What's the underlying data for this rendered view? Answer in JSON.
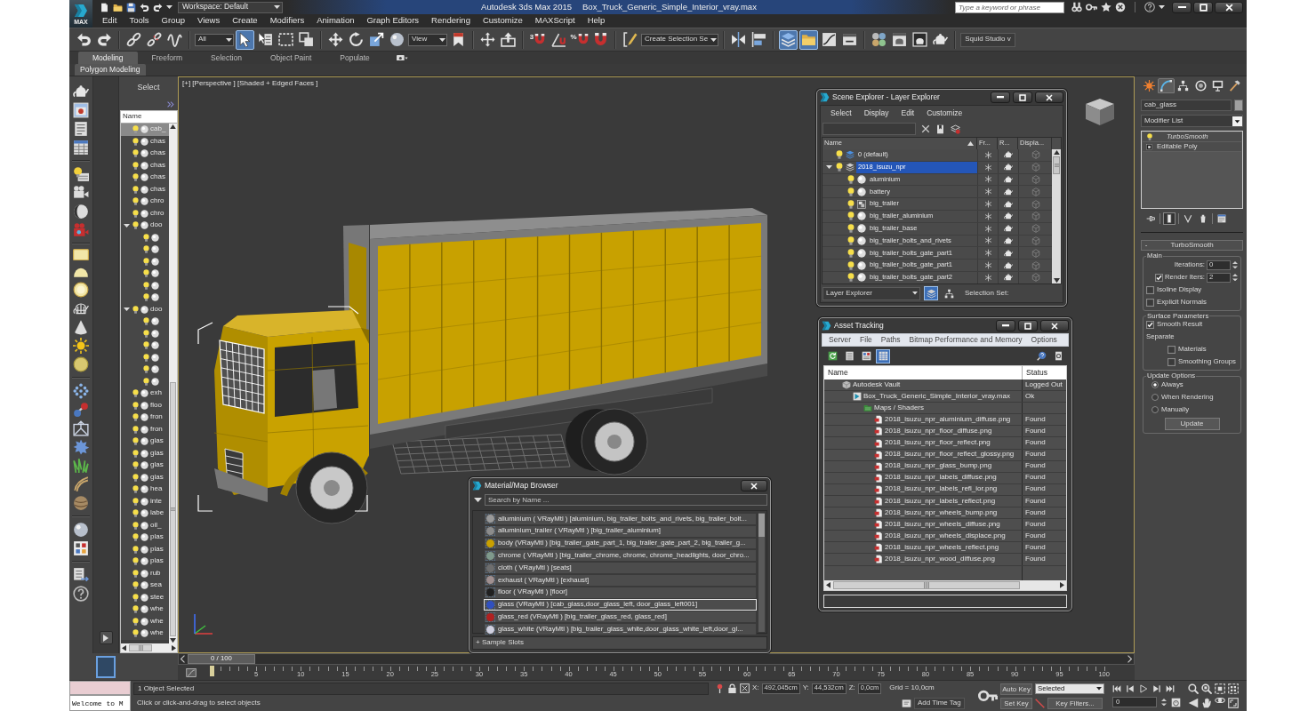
{
  "title_bar": {
    "app_button": "MAX",
    "workspace": "Workspace: Default",
    "app_name": "Autodesk 3ds Max 2015",
    "file_name": "Box_Truck_Generic_Simple_Interior_vray.max",
    "search": {
      "placeholder": "Type a keyword or phrase"
    }
  },
  "menu": [
    "Edit",
    "Tools",
    "Group",
    "Views",
    "Create",
    "Modifiers",
    "Animation",
    "Graph Editors",
    "Rendering",
    "Customize",
    "MAXScript",
    "Help"
  ],
  "main_toolbar": [
    {
      "kind": "button",
      "selected": false
    },
    {
      "kind": "button",
      "selected": false
    },
    {
      "kind": "button",
      "selected": false
    },
    {
      "kind": "button",
      "selected": false
    },
    {
      "kind": "button",
      "selected": false
    },
    {
      "kind": "dropdown",
      "value": "All"
    },
    {
      "kind": "button",
      "selected": true
    },
    {
      "kind": "button",
      "selected": false
    },
    {
      "kind": "button",
      "selected": false
    },
    {
      "kind": "button",
      "selected": false
    },
    {
      "kind": "button",
      "selected": false
    },
    {
      "kind": "button",
      "selected": false
    },
    {
      "kind": "button",
      "selected": false
    },
    {
      "kind": "button",
      "selected": false
    },
    {
      "kind": "dropdown",
      "value": "View"
    },
    {
      "kind": "button",
      "selected": false
    },
    {
      "kind": "button",
      "selected": false
    },
    {
      "kind": "button",
      "selected": false
    },
    {
      "kind": "snap",
      "label": "3",
      "selected": false
    },
    {
      "kind": "button",
      "selected": false
    },
    {
      "kind": "snap",
      "label": "%",
      "selected": false
    },
    {
      "kind": "button",
      "selected": false
    },
    {
      "kind": "button",
      "selected": false
    },
    {
      "kind": "dropdown",
      "value": "Create Selection Se"
    },
    {
      "kind": "button",
      "selected": false
    },
    {
      "kind": "button",
      "selected": false
    },
    {
      "kind": "button",
      "selected": true
    },
    {
      "kind": "button",
      "selected": true
    },
    {
      "kind": "button",
      "selected": false
    },
    {
      "kind": "button",
      "selected": false
    },
    {
      "kind": "button",
      "selected": false
    },
    {
      "kind": "button",
      "selected": false
    },
    {
      "kind": "button",
      "selected": false
    },
    {
      "kind": "button",
      "selected": false
    },
    {
      "kind": "field",
      "value": "Squid Studio v"
    }
  ],
  "ribbon": {
    "tabs": [
      {
        "label": "Modeling",
        "selected": true
      },
      {
        "label": "Freeform",
        "selected": false
      },
      {
        "label": "Selection",
        "selected": false
      },
      {
        "label": "Object Paint",
        "selected": false
      },
      {
        "label": "Populate",
        "selected": false
      }
    ],
    "panel": "Polygon Modeling"
  },
  "scene_explorer": {
    "header": "Select",
    "column": "Name",
    "items": [
      {
        "name": "cab_",
        "selected": true,
        "expanded": false
      },
      {
        "name": "chas",
        "selected": false,
        "expanded": false
      },
      {
        "name": "chas",
        "selected": false,
        "expanded": false
      },
      {
        "name": "chas",
        "selected": false,
        "expanded": false
      },
      {
        "name": "chas",
        "selected": false,
        "expanded": false
      },
      {
        "name": "chas",
        "selected": false,
        "expanded": false
      },
      {
        "name": "chro",
        "selected": false,
        "expanded": false
      },
      {
        "name": "chro",
        "selected": false,
        "expanded": false
      },
      {
        "name": "doo",
        "selected": false,
        "expanded": true,
        "children": [
          {
            "selected": false
          },
          {
            "selected": false
          },
          {
            "selected": false
          },
          {
            "selected": false
          },
          {
            "selected": false
          },
          {
            "selected": false
          }
        ]
      },
      {
        "name": "doo",
        "selected": false,
        "expanded": true,
        "children": [
          {
            "selected": false
          },
          {
            "selected": false
          },
          {
            "selected": false
          },
          {
            "selected": false
          },
          {
            "selected": false
          },
          {
            "selected": false
          }
        ]
      },
      {
        "name": "exh",
        "selected": false,
        "expanded": false
      },
      {
        "name": "floo",
        "selected": false,
        "expanded": false
      },
      {
        "name": "fron",
        "selected": false,
        "expanded": false
      },
      {
        "name": "fron",
        "selected": false,
        "expanded": false
      },
      {
        "name": "glas",
        "selected": false,
        "expanded": false
      },
      {
        "name": "glas",
        "selected": false,
        "expanded": false
      },
      {
        "name": "glas",
        "selected": false,
        "expanded": false
      },
      {
        "name": "glas",
        "selected": false,
        "expanded": false
      },
      {
        "name": "hea",
        "selected": false,
        "expanded": false
      },
      {
        "name": "inte",
        "selected": false,
        "expanded": false
      },
      {
        "name": "labe",
        "selected": false,
        "expanded": false
      },
      {
        "name": "oil_",
        "selected": false,
        "expanded": false
      },
      {
        "name": "plas",
        "selected": false,
        "expanded": false
      },
      {
        "name": "plas",
        "selected": false,
        "expanded": false
      },
      {
        "name": "plas",
        "selected": false,
        "expanded": false
      },
      {
        "name": "rub",
        "selected": false,
        "expanded": false
      },
      {
        "name": "sea",
        "selected": false,
        "expanded": false
      },
      {
        "name": "stee",
        "selected": false,
        "expanded": false
      },
      {
        "name": "whe",
        "selected": false,
        "expanded": false
      },
      {
        "name": "whe",
        "selected": false,
        "expanded": false
      },
      {
        "name": "whe",
        "selected": false,
        "expanded": false
      }
    ]
  },
  "viewport": {
    "label": "[+] [Perspective ] [Shaded + Edged Faces ]"
  },
  "layer_explorer": {
    "title": "Scene Explorer - Layer Explorer",
    "menu": [
      "Select",
      "Display",
      "Edit",
      "Customize"
    ],
    "columns": [
      "Name",
      "Fr...",
      "R...",
      "Displa..."
    ],
    "rows": [
      {
        "name": "0 (default)",
        "kind": "active_layer",
        "selected": false,
        "expanded": false
      },
      {
        "name": "2018_isuzu_npr",
        "kind": "layer",
        "selected": true,
        "expanded": true,
        "children": [
          {
            "name": "aluminium",
            "kind": "object",
            "selected": false
          },
          {
            "name": "battery",
            "kind": "object",
            "selected": false
          },
          {
            "name": "big_trailer",
            "kind": "group",
            "selected": false
          },
          {
            "name": "big_trailer_aluminium",
            "kind": "object",
            "selected": false
          },
          {
            "name": "big_trailer_base",
            "kind": "object",
            "selected": false
          },
          {
            "name": "big_trailer_bolts_and_rivets",
            "kind": "object",
            "selected": false
          },
          {
            "name": "big_trailer_bolts_gate_part1",
            "kind": "object",
            "selected": false
          },
          {
            "name": "big_trailer_bolts_gate_part1",
            "kind": "object",
            "selected": false
          },
          {
            "name": "big_trailer_bolts_gate_part2",
            "kind": "object",
            "selected": false
          }
        ]
      }
    ],
    "mode": "Layer Explorer",
    "views": [
      {
        "selected": true
      },
      {
        "selected": false
      }
    ],
    "selection_set": "Selection Set:"
  },
  "asset_tracking": {
    "title": "Asset Tracking",
    "menu": [
      "Server",
      "File",
      "Paths",
      "Bitmap Performance and Memory",
      "Options"
    ],
    "toolbar": [
      {
        "selected": false
      },
      {
        "selected": false
      },
      {
        "selected": false
      },
      {
        "selected": true
      },
      {
        "selected": false
      },
      {
        "selected": false
      }
    ],
    "columns": [
      "Name",
      "Status"
    ],
    "rows": [
      {
        "name": "Autodesk Vault",
        "status": "Logged Out",
        "kind": "vault",
        "children": [
          {
            "name": "Box_Truck_Generic_Simple_Interior_vray.max",
            "status": "Ok",
            "kind": "file",
            "children": [
              {
                "name": "Maps / Shaders",
                "kind": "folder",
                "children": [
                  {
                    "name": "2018_isuzu_npr_aluminium_diffuse.png",
                    "status": "Found",
                    "kind": "bitmap"
                  },
                  {
                    "name": "2018_isuzu_npr_floor_diffuse.png",
                    "status": "Found",
                    "kind": "bitmap"
                  },
                  {
                    "name": "2018_isuzu_npr_floor_reflect.png",
                    "status": "Found",
                    "kind": "bitmap"
                  },
                  {
                    "name": "2018_isuzu_npr_floor_reflect_glossy.png",
                    "status": "Found",
                    "kind": "bitmap"
                  },
                  {
                    "name": "2018_isuzu_npr_glass_bump.png",
                    "status": "Found",
                    "kind": "bitmap"
                  },
                  {
                    "name": "2018_isuzu_npr_labels_diffuse.png",
                    "status": "Found",
                    "kind": "bitmap"
                  },
                  {
                    "name": "2018_isuzu_npr_labels_refl_ior.png",
                    "status": "Found",
                    "kind": "bitmap"
                  },
                  {
                    "name": "2018_isuzu_npr_labels_reflect.png",
                    "status": "Found",
                    "kind": "bitmap"
                  },
                  {
                    "name": "2018_isuzu_npr_wheels_bump.png",
                    "status": "Found",
                    "kind": "bitmap"
                  },
                  {
                    "name": "2018_isuzu_npr_wheels_diffuse.png",
                    "status": "Found",
                    "kind": "bitmap"
                  },
                  {
                    "name": "2018_isuzu_npr_wheels_displace.png",
                    "status": "Found",
                    "kind": "bitmap"
                  },
                  {
                    "name": "2018_isuzu_npr_wheels_reflect.png",
                    "status": "Found",
                    "kind": "bitmap"
                  },
                  {
                    "name": "2018_isuzu_npr_wood_diffuse.png",
                    "status": "Found",
                    "kind": "bitmap"
                  }
                ]
              }
            ]
          }
        ]
      }
    ]
  },
  "material_browser": {
    "title": "Material/Map Browser",
    "search": {
      "placeholder": "Search by Name ..."
    },
    "items": [
      {
        "label": "alluminium ( VRayMtl ) [aluminium, big_trailer_bolts_and_rivets, big_trailer_bolt...",
        "color": "#9a9a9a",
        "selected": false
      },
      {
        "label": "alluminium_trailer ( VRayMtl ) [big_trailer_aluminium]",
        "color": "#8c8c8c",
        "selected": false
      },
      {
        "label": "body (VRayMtl ) [big_trailer_gate_part_1, big_trailer_gate_part_2, big_trailer_g...",
        "color": "#c9a000",
        "selected": false
      },
      {
        "label": "chrome ( VRayMtl ) [big_trailer_chrome, chrome, chrome_headlights, door_chro...",
        "color": "#7f9a8c",
        "selected": false
      },
      {
        "label": "cloth ( VRayMtl ) [seats]",
        "color": "#6e6e6e",
        "selected": false
      },
      {
        "label": "exhaust ( VRayMtl ) [exhaust]",
        "color": "#a09090",
        "selected": false
      },
      {
        "label": "floor ( VRayMtl ) [floor]",
        "color": "#202020",
        "selected": false
      },
      {
        "label": "glass (VRayMtl ) [cab_glass,door_glass_left, door_glass_left001]",
        "color": "#3050c0",
        "selected": true
      },
      {
        "label": "glass_red (VRayMtl ) [big_trailer_glass_red, glass_red]",
        "color": "#b02020",
        "selected": false
      },
      {
        "label": "glass_white (VRayMtl ) [big_trailer_glass_white,door_glass_white_left,door_gl...",
        "color": "#d0d0e0",
        "selected": false
      }
    ],
    "footer": "+ Sample Slots"
  },
  "command_panel": {
    "tabs": [
      {
        "selected": false
      },
      {
        "selected": true
      },
      {
        "selected": false
      },
      {
        "selected": false
      },
      {
        "selected": false
      },
      {
        "selected": false
      }
    ],
    "object_name": "cab_glass",
    "modifier_list": "Modifier List",
    "stack": [
      {
        "name": "TurboSmooth",
        "kind": "modifier"
      },
      {
        "name": "Editable Poly",
        "kind": "base"
      }
    ],
    "stack_tools": [
      {
        "selected": false
      },
      {
        "selected": true
      },
      {
        "selected": false
      },
      {
        "selected": false
      },
      {
        "selected": false
      }
    ],
    "rollout": {
      "toggle": "-",
      "title": "TurboSmooth",
      "groups": [
        {
          "title": "Main",
          "controls": [
            {
              "kind": "spinner",
              "label": "Iterations:",
              "value": "0"
            },
            {
              "kind": "check_spinner",
              "label": "Render Iters:",
              "checked": true,
              "value": "2"
            },
            {
              "kind": "checkbox",
              "label": "Isoline Display",
              "checked": false
            },
            {
              "kind": "checkbox",
              "label": "Explicit Normals",
              "checked": false
            }
          ]
        },
        {
          "title": "Surface Parameters",
          "controls": [
            {
              "kind": "checkbox",
              "label": "Smooth Result",
              "checked": true
            },
            {
              "kind": "label",
              "label": "Separate"
            },
            {
              "kind": "subcheckbox",
              "label": "Materials",
              "checked": false
            },
            {
              "kind": "subcheckbox",
              "label": "Smoothing Groups",
              "checked": false
            }
          ]
        },
        {
          "title": "Update Options",
          "controls": [
            {
              "kind": "radio",
              "label": "Always",
              "selected": true
            },
            {
              "kind": "radio",
              "label": "When Rendering",
              "selected": false
            },
            {
              "kind": "radio",
              "label": "Manually",
              "selected": false
            },
            {
              "kind": "button",
              "label": "Update"
            }
          ]
        }
      ]
    }
  },
  "time_slider": {
    "position": "0 / 100",
    "level": 0,
    "ticks": [
      "5",
      "10",
      "15",
      "20",
      "25",
      "30",
      "35",
      "40",
      "45",
      "50",
      "55",
      "60",
      "65",
      "70",
      "75",
      "80",
      "85",
      "90",
      "95",
      "100"
    ]
  },
  "status_bar": {
    "listener_output": "Welcome to M",
    "selection": "1 Object Selected",
    "prompt": "Click or click-and-drag to select objects",
    "coordinates": [
      {
        "axis": "X:",
        "value": "492,045cm"
      },
      {
        "axis": "Y:",
        "value": "44,532cm"
      },
      {
        "axis": "Z:",
        "value": "0,0cm"
      }
    ],
    "grid": "Grid = 10,0cm",
    "time_tag": "Add Time Tag",
    "auto_key": "Auto Key",
    "key_mode": "Selected",
    "set_key": "Set Key",
    "key_filters": "Key Filters...",
    "frame": "0"
  }
}
